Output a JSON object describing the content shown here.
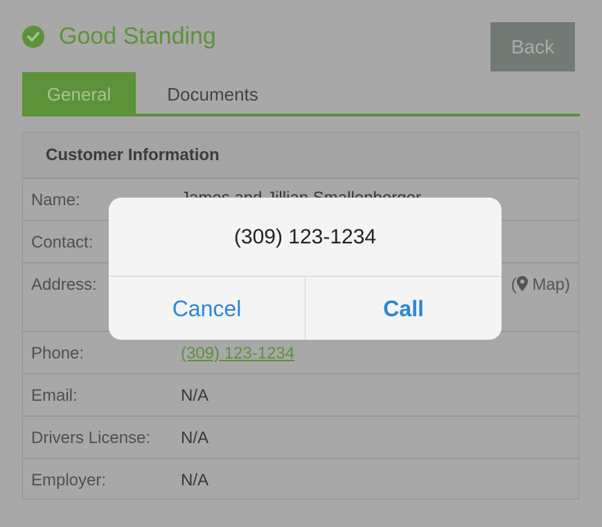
{
  "header": {
    "status_icon": "check-circle-icon",
    "status_text": "Good Standing",
    "back_label": "Back"
  },
  "tabs": [
    {
      "label": "General",
      "active": true
    },
    {
      "label": "Documents",
      "active": false
    }
  ],
  "panel": {
    "title": "Customer Information",
    "rows": [
      {
        "label": "Name:",
        "value": "James and Jillian Smallenberger"
      },
      {
        "label": "Contact:",
        "value": ""
      },
      {
        "label": "Address:",
        "value": "",
        "map_label": "Map",
        "map_icon": "map-marker-icon"
      },
      {
        "label": "Phone:",
        "value": "(309) 123-1234 "
      },
      {
        "label": "Email:",
        "value": "N/A"
      },
      {
        "label": "Drivers License:",
        "value": "N/A"
      },
      {
        "label": "Employer:",
        "value": "N/A"
      }
    ]
  },
  "dialog": {
    "title": "(309) 123-1234",
    "cancel_label": "Cancel",
    "call_label": "Call"
  },
  "colors": {
    "brand_green": "#5b923a",
    "ios_blue": "#2c86d8",
    "back_button": "#717a75"
  }
}
